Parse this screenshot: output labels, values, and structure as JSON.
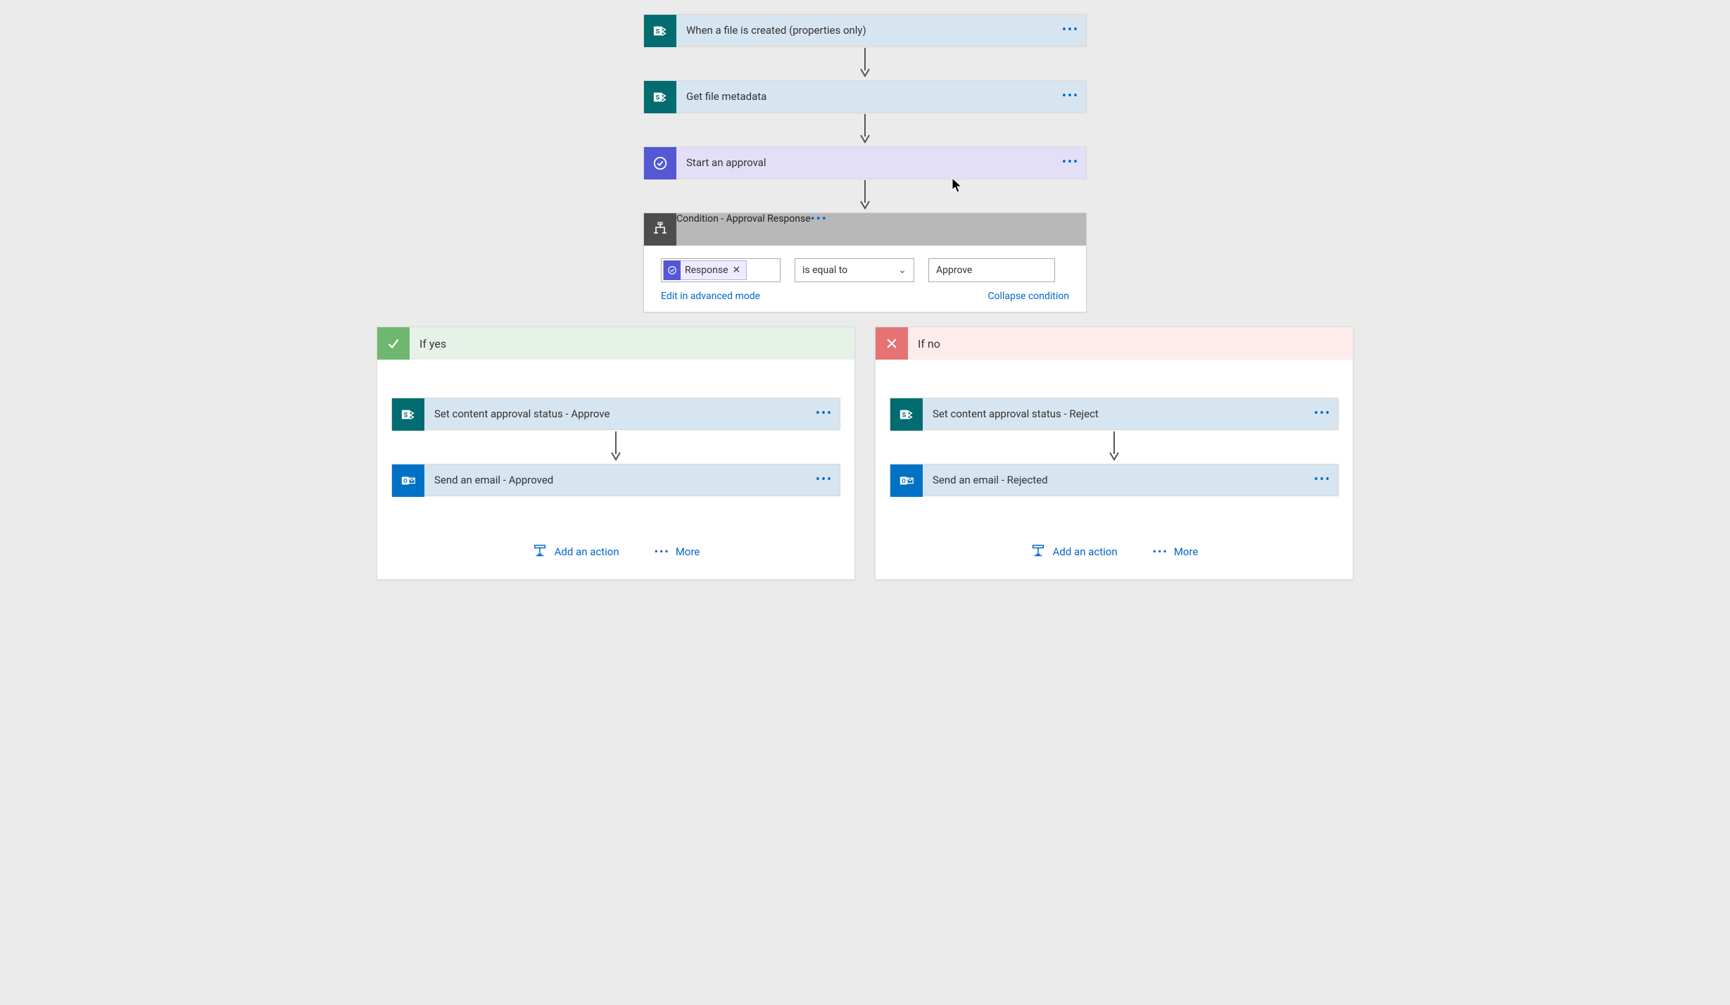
{
  "flow": {
    "steps": [
      {
        "id": "trigger",
        "label": "When a file is created (properties only)",
        "iconType": "sharepoint",
        "body": "sp-blue"
      },
      {
        "id": "get-metadata",
        "label": "Get file metadata",
        "iconType": "sharepoint",
        "body": "sp-blue"
      },
      {
        "id": "start-approval",
        "label": "Start an approval",
        "iconType": "approval",
        "body": "approval-bg"
      }
    ],
    "condition": {
      "header_label": "Condition - Approval Response",
      "token_label": "Response",
      "operator": "is equal to",
      "value": "Approve",
      "edit_link": "Edit in advanced mode",
      "collapse_link": "Collapse condition"
    },
    "branches": {
      "yes": {
        "title": "If yes",
        "steps": [
          {
            "label": "Set content approval status - Approve",
            "iconType": "sharepoint",
            "body": "sp-blue"
          },
          {
            "label": "Send an email - Approved",
            "iconType": "outlook",
            "body": "sp-blue"
          }
        ],
        "add_action": "Add an action",
        "more": "More"
      },
      "no": {
        "title": "If no",
        "steps": [
          {
            "label": "Set content approval status - Reject",
            "iconType": "sharepoint",
            "body": "sp-blue"
          },
          {
            "label": "Send an email - Rejected",
            "iconType": "outlook",
            "body": "sp-blue"
          }
        ],
        "add_action": "Add an action",
        "more": "More"
      }
    }
  }
}
